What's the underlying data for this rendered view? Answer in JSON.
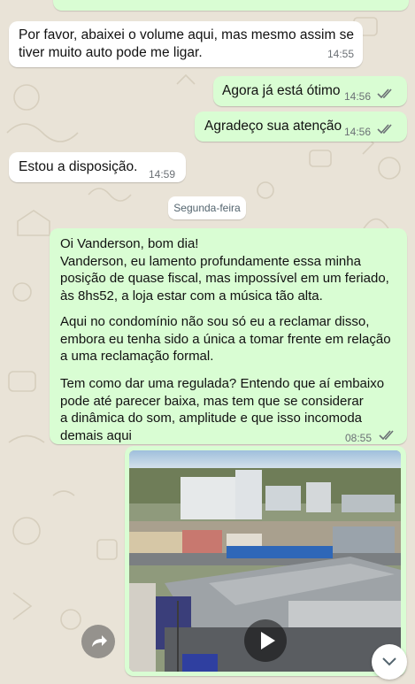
{
  "colors": {
    "wallpaper": "#e9e3d7",
    "incoming_bubble": "#ffffff",
    "outgoing_bubble": "#d9fdd3",
    "read_ticks": "#53bdeb",
    "sent_ticks": "#6b7075"
  },
  "messages": [
    {
      "direction": "incoming",
      "text": "Por favor, abaixei o volume aqui, mas mesmo assim se\ntiver muito auto pode me ligar.",
      "time": "14:55"
    },
    {
      "direction": "outgoing",
      "text": "Agora já está ótimo",
      "time": "14:56",
      "status_icon": "double-check-icon"
    },
    {
      "direction": "outgoing",
      "text": "Agradeço sua atenção",
      "time": "14:56",
      "status_icon": "double-check-icon"
    },
    {
      "direction": "incoming",
      "text": "Estou a disposição.",
      "time": "14:59"
    }
  ],
  "day_separator": "Segunda-feira",
  "long_message": {
    "direction": "outgoing",
    "paragraph_1": "Oi Vanderson, bom dia!\nVanderson, eu lamento profundamente essa minha\nposição de quase fiscal, mas impossível em um feriado,\nàs 8hs52, a loja estar com a música tão alta.",
    "paragraph_2": "Aqui no condomínio não sou só eu a reclamar disso,\nembora eu tenha sido a única a tomar frente em relação\na uma reclamação formal.",
    "paragraph_3": "Tem como dar uma regulada? Entendo que aí embaixo\npode até parecer baixa, mas tem que se considerar\na dinâmica do som, amplitude e que isso incomoda\ndemais aqui",
    "time": "08:55",
    "status_icon": "double-check-icon"
  },
  "media_message": {
    "type": "video",
    "description_icon": "video-thumbnail",
    "controls": [
      "forward-icon",
      "play-icon",
      "scroll-down-icon"
    ]
  }
}
